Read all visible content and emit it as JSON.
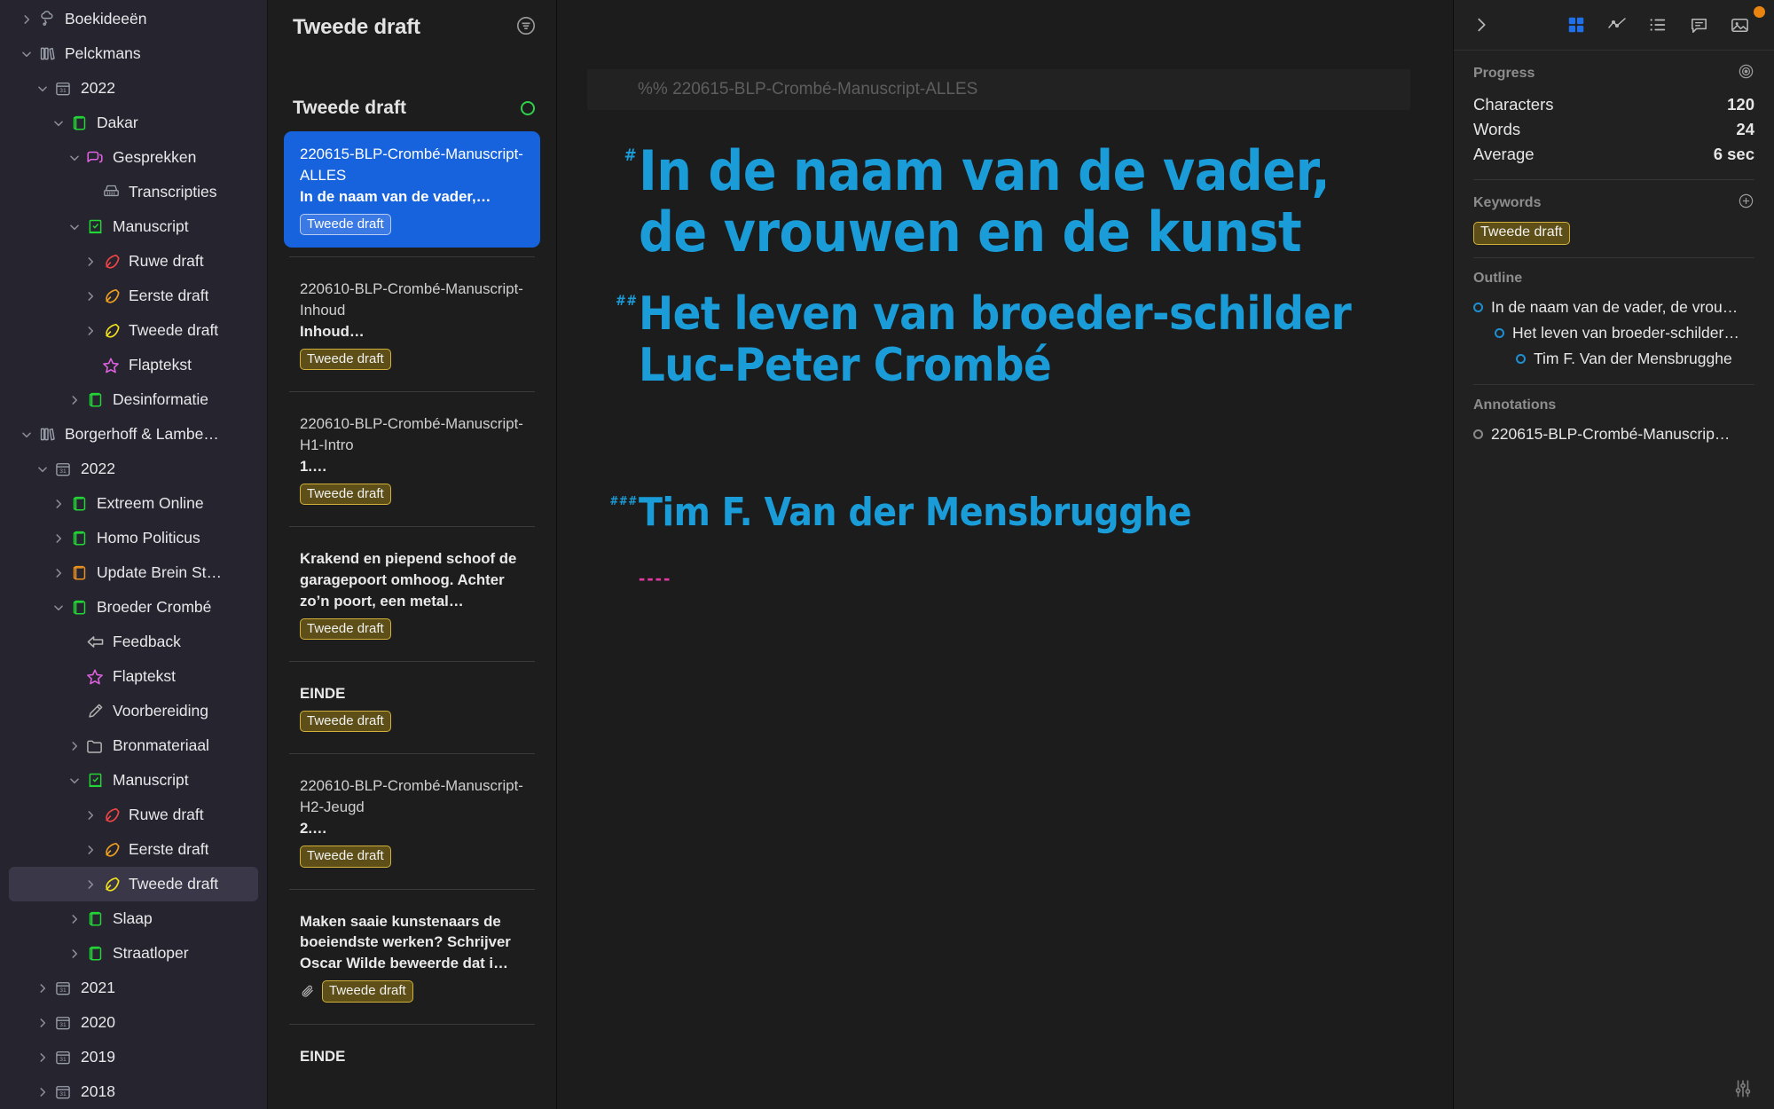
{
  "sidebar": {
    "items": [
      {
        "label": "Boekideeën",
        "depth": 0,
        "twisty": "right",
        "icon": "cloud-idea-icon",
        "icon_color": "#9aa0aa",
        "selected": false
      },
      {
        "label": "Pelckmans",
        "depth": 0,
        "twisty": "down",
        "icon": "books-icon",
        "icon_color": "#9aa0aa",
        "selected": false
      },
      {
        "label": "2022",
        "depth": 1,
        "twisty": "down",
        "icon": "calendar-icon",
        "icon_color": "#9aa0aa",
        "selected": false
      },
      {
        "label": "Dakar",
        "depth": 2,
        "twisty": "down",
        "icon": "book-icon",
        "icon_color": "#22d636",
        "selected": false
      },
      {
        "label": "Gesprekken",
        "depth": 3,
        "twisty": "down",
        "icon": "chat-icon",
        "icon_color": "#e062e0",
        "selected": false
      },
      {
        "label": "Transcripties",
        "depth": 4,
        "twisty": "none",
        "icon": "typewriter-icon",
        "icon_color": "#9aa0aa",
        "selected": false
      },
      {
        "label": "Manuscript",
        "depth": 3,
        "twisty": "down",
        "icon": "checked-book-icon",
        "icon_color": "#22d636",
        "selected": false
      },
      {
        "label": "Ruwe draft",
        "depth": 4,
        "twisty": "right",
        "icon": "pen-nib-icon",
        "icon_color": "#f04545",
        "selected": false
      },
      {
        "label": "Eerste draft",
        "depth": 4,
        "twisty": "right",
        "icon": "pen-nib-icon",
        "icon_color": "#f0a020",
        "selected": false
      },
      {
        "label": "Tweede draft",
        "depth": 4,
        "twisty": "right",
        "icon": "pen-nib-icon",
        "icon_color": "#f2e11a",
        "selected": false
      },
      {
        "label": "Flaptekst",
        "depth": 4,
        "twisty": "none",
        "icon": "star-icon",
        "icon_color": "#e062e0",
        "selected": false
      },
      {
        "label": "Desinformatie",
        "depth": 3,
        "twisty": "right",
        "icon": "book-icon",
        "icon_color": "#22d636",
        "selected": false
      },
      {
        "label": "Borgerhoff & Lambe…",
        "depth": 0,
        "twisty": "down",
        "icon": "books-icon",
        "icon_color": "#9aa0aa",
        "selected": false
      },
      {
        "label": "2022",
        "depth": 1,
        "twisty": "down",
        "icon": "calendar-icon",
        "icon_color": "#9aa0aa",
        "selected": false
      },
      {
        "label": "Extreem Online",
        "depth": 2,
        "twisty": "right",
        "icon": "book-icon",
        "icon_color": "#22d636",
        "selected": false
      },
      {
        "label": "Homo Politicus",
        "depth": 2,
        "twisty": "right",
        "icon": "book-icon",
        "icon_color": "#22d636",
        "selected": false
      },
      {
        "label": "Update Brein St…",
        "depth": 2,
        "twisty": "right",
        "icon": "book-icon",
        "icon_color": "#e89020",
        "selected": false
      },
      {
        "label": "Broeder Crombé",
        "depth": 2,
        "twisty": "down",
        "icon": "book-icon",
        "icon_color": "#22d636",
        "selected": false
      },
      {
        "label": "Feedback",
        "depth": 3,
        "twisty": "none",
        "icon": "left-arrow-icon",
        "icon_color": "#b6b6b6",
        "selected": false
      },
      {
        "label": "Flaptekst",
        "depth": 3,
        "twisty": "none",
        "icon": "star-icon",
        "icon_color": "#e062e0",
        "selected": false
      },
      {
        "label": "Voorbereiding",
        "depth": 3,
        "twisty": "none",
        "icon": "pencil-icon",
        "icon_color": "#b6b6b6",
        "selected": false
      },
      {
        "label": "Bronmateriaal",
        "depth": 3,
        "twisty": "right",
        "icon": "folder-icon",
        "icon_color": "#b6b6b6",
        "selected": false
      },
      {
        "label": "Manuscript",
        "depth": 3,
        "twisty": "down",
        "icon": "checked-book-icon",
        "icon_color": "#22d636",
        "selected": false
      },
      {
        "label": "Ruwe draft",
        "depth": 4,
        "twisty": "right",
        "icon": "pen-nib-icon",
        "icon_color": "#f04545",
        "selected": false
      },
      {
        "label": "Eerste draft",
        "depth": 4,
        "twisty": "right",
        "icon": "pen-nib-icon",
        "icon_color": "#f0a020",
        "selected": false
      },
      {
        "label": "Tweede draft",
        "depth": 4,
        "twisty": "right",
        "icon": "pen-nib-icon",
        "icon_color": "#f2e11a",
        "selected": true
      },
      {
        "label": "Slaap",
        "depth": 3,
        "twisty": "right",
        "icon": "book-icon",
        "icon_color": "#22d636",
        "selected": false
      },
      {
        "label": "Straatloper",
        "depth": 3,
        "twisty": "right",
        "icon": "book-icon",
        "icon_color": "#22d636",
        "selected": false
      },
      {
        "label": "2021",
        "depth": 1,
        "twisty": "right",
        "icon": "calendar-icon",
        "icon_color": "#9aa0aa",
        "selected": false
      },
      {
        "label": "2020",
        "depth": 1,
        "twisty": "right",
        "icon": "calendar-icon",
        "icon_color": "#9aa0aa",
        "selected": false
      },
      {
        "label": "2019",
        "depth": 1,
        "twisty": "right",
        "icon": "calendar-icon",
        "icon_color": "#9aa0aa",
        "selected": false
      },
      {
        "label": "2018",
        "depth": 1,
        "twisty": "right",
        "icon": "calendar-icon",
        "icon_color": "#9aa0aa",
        "selected": false
      }
    ]
  },
  "notelist": {
    "header_title": "Tweede draft",
    "sort_icon": "sort-lines-icon",
    "group_title": "Tweede draft",
    "status_indicator": "green-circle-icon",
    "notes": [
      {
        "path": "220615-BLP-Crombé-Manuscript-ALLES",
        "excerpt": "In de naam van de vader,…",
        "tag": "Tweede draft",
        "has_attachment": false,
        "active": true
      },
      {
        "path": "220610-BLP-Crombé-Manuscript-Inhoud",
        "excerpt": "Inhoud…",
        "tag": "Tweede draft",
        "has_attachment": false,
        "active": false
      },
      {
        "path": "220610-BLP-Crombé-Manuscript-H1-Intro",
        "excerpt": "1.…",
        "tag": "Tweede draft",
        "has_attachment": false,
        "active": false
      },
      {
        "path": "",
        "excerpt": "Krakend en piepend schoof de garagepoort omhoog. Achter zo’n poort, een metal…",
        "tag": "Tweede draft",
        "has_attachment": false,
        "active": false
      },
      {
        "path": "",
        "excerpt": "EINDE",
        "tag": "Tweede draft",
        "has_attachment": false,
        "active": false
      },
      {
        "path": "220610-BLP-Crombé-Manuscript-H2-Jeugd",
        "excerpt": "2.…",
        "tag": "Tweede draft",
        "has_attachment": false,
        "active": false
      },
      {
        "path": "",
        "excerpt": "Maken saaie kunstenaars de boeiendste werken? Schrijver Oscar Wilde beweerde dat i…",
        "tag": "Tweede draft",
        "has_attachment": true,
        "active": false
      },
      {
        "path": "",
        "excerpt": "EINDE",
        "tag": "",
        "has_attachment": false,
        "active": false
      }
    ]
  },
  "editor": {
    "meta_comment": "%% 220615-BLP-Crombé-Manuscript-ALLES",
    "blocks": [
      {
        "marker": "#",
        "level": 1,
        "text": "In de naam van de vader, de vrouwen en de kunst"
      },
      {
        "marker": "##",
        "level": 2,
        "text": "Het leven van broeder-schilder Luc-Peter Crombé"
      },
      {
        "marker": "###",
        "level": 3,
        "text": "Tim F. Van der Mensbrugghe"
      }
    ],
    "horizontal_rule": "----",
    "heading_color": "#1a9cd8",
    "rule_color": "#e0399f"
  },
  "inspector": {
    "toolbar": {
      "collapse_icon": "chevron-right-icon",
      "buttons": [
        {
          "icon": "grid-icon",
          "active": true
        },
        {
          "icon": "chart-line-icon",
          "active": false
        },
        {
          "icon": "list-icon",
          "active": false
        },
        {
          "icon": "comment-icon",
          "active": false
        },
        {
          "icon": "image-icon",
          "active": false
        }
      ],
      "notification_dot_color": "#e8840f"
    },
    "progress": {
      "title": "Progress",
      "target_icon": "target-icon",
      "rows": [
        {
          "label": "Characters",
          "value": "120"
        },
        {
          "label": "Words",
          "value": "24"
        },
        {
          "label": "Average",
          "value": "6 sec"
        }
      ]
    },
    "keywords": {
      "title": "Keywords",
      "add_icon": "plus-circle-icon",
      "tags": [
        "Tweede draft"
      ]
    },
    "outline": {
      "title": "Outline",
      "items": [
        {
          "label": "In de naam van de vader, de vrou…",
          "level": 1
        },
        {
          "label": "Het leven van broeder-schilder…",
          "level": 2
        },
        {
          "label": "Tim F. Van der Mensbrugghe",
          "level": 3
        }
      ]
    },
    "annotations": {
      "title": "Annotations",
      "items": [
        {
          "label": "220615-BLP-Crombé-Manuscrip…"
        }
      ]
    },
    "statusbar": {
      "icon": "sliders-icon"
    }
  }
}
